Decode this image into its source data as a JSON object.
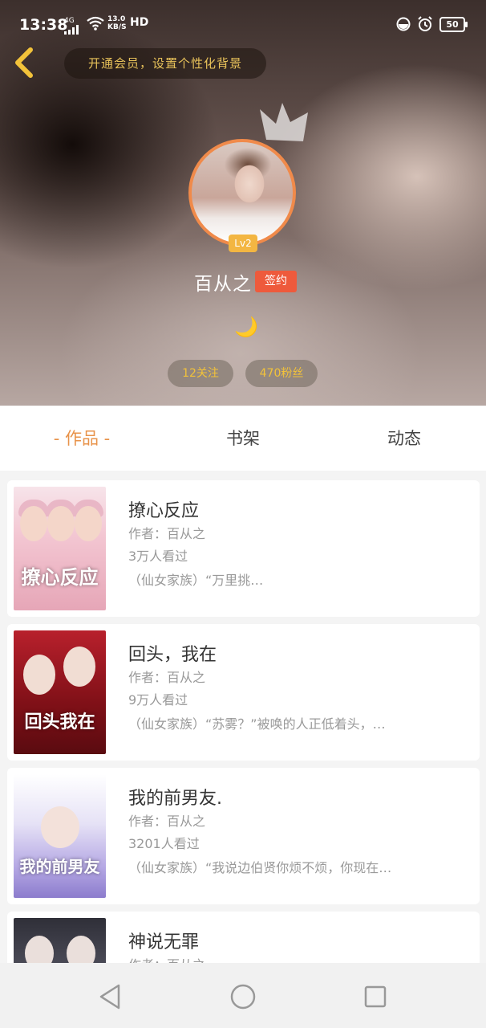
{
  "status_bar": {
    "time": "13:38",
    "network": "4G",
    "speed_top": "13.0",
    "speed_bottom": "KB/S",
    "hd": "HD",
    "battery": "50"
  },
  "header": {
    "vip_banner": "开通会员，设置个性化背景",
    "level": "Lv2",
    "username": "百从之",
    "signed_badge": "签约",
    "moon": "🌙",
    "follows": "12关注",
    "fans": "470粉丝"
  },
  "tabs": [
    {
      "label": "- 作品 -",
      "active": true
    },
    {
      "label": "书架",
      "active": false
    },
    {
      "label": "动态",
      "active": false
    }
  ],
  "books": [
    {
      "title": "撩心反应",
      "author": "作者：百从之",
      "views": "3万人看过",
      "desc": "（仙女家族）“万里挑…",
      "cover_text": "撩心反应"
    },
    {
      "title": "回头，我在",
      "author": "作者：百从之",
      "views": "9万人看过",
      "desc": "（仙女家族）“苏雾？”被唤的人正低着头，…",
      "cover_text": "回头我在"
    },
    {
      "title": "我的前男友.",
      "author": "作者：百从之",
      "views": "3201人看过",
      "desc": "（仙女家族）“我说边伯贤你烦不烦，你现在…",
      "cover_text": "我的前男友"
    },
    {
      "title": "神说无罪",
      "author": "作者：百从之",
      "views": "",
      "desc": "",
      "cover_text": ""
    }
  ],
  "colors": {
    "accent": "#e8934a",
    "gold": "#f2c23a",
    "sign_red": "#ee5a3c",
    "level_yellow": "#f3b642"
  }
}
